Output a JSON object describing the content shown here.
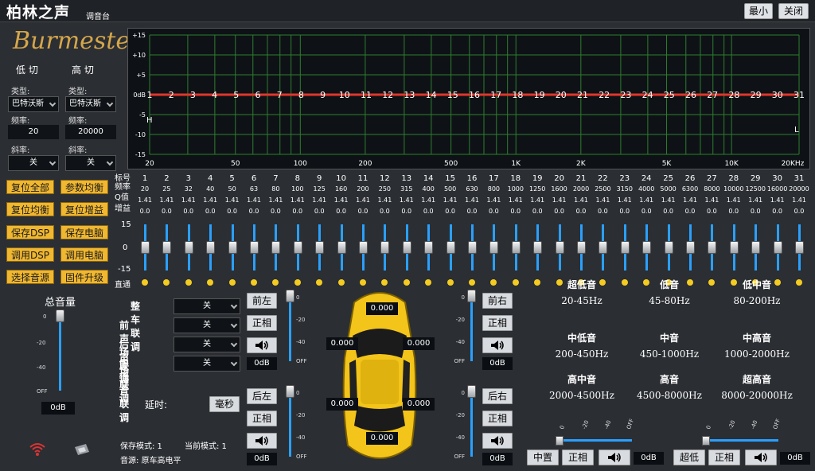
{
  "app": {
    "title": "柏林之声",
    "subtitle": "调音台",
    "min_label": "最小",
    "close_label": "关闭",
    "logo_text": "Burmester"
  },
  "crossover": {
    "low_cut": {
      "heading": "低 切",
      "type_label": "类型:",
      "type_value": "巴特沃斯",
      "freq_label": "频率:",
      "freq_value": "20",
      "slope_label": "斜率:",
      "slope_value": "关"
    },
    "high_cut": {
      "heading": "高 切",
      "type_label": "类型:",
      "type_value": "巴特沃斯",
      "freq_label": "频率:",
      "freq_value": "20000",
      "slope_label": "斜率:",
      "slope_value": "关"
    }
  },
  "buttons": [
    "复位全部",
    "参数均衡",
    "复位均衡",
    "复位增益",
    "保存DSP",
    "保存电脑",
    "调用DSP",
    "调用电脑",
    "选择音源",
    "固件升级"
  ],
  "master": {
    "label": "总音量",
    "ticks": [
      "0",
      "-20",
      "-40",
      "OFF"
    ],
    "value": "0dB",
    "level": 1.0
  },
  "graph": {
    "y_ticks": [
      "+15",
      "+10",
      "+5",
      "0dB",
      "-5",
      "-10",
      "-15"
    ],
    "x_ticks": [
      "20",
      "50",
      "100",
      "200",
      "500",
      "1K",
      "2K",
      "5K",
      "10K",
      "20KHz"
    ],
    "h_marker": "H",
    "l_marker": "L",
    "line_color": "#e0352b",
    "grid_color": "#2e7d2e"
  },
  "eq": {
    "row_labels": [
      "标号",
      "频率",
      "Q值",
      "增益"
    ],
    "gain_scale": [
      "15",
      "0",
      "-15"
    ],
    "bypass_label": "直通",
    "bands": [
      {
        "n": "1",
        "f": "20",
        "q": "1.41",
        "g": "0.0"
      },
      {
        "n": "2",
        "f": "25",
        "q": "1.41",
        "g": "0.0"
      },
      {
        "n": "3",
        "f": "32",
        "q": "1.41",
        "g": "0.0"
      },
      {
        "n": "4",
        "f": "40",
        "q": "1.41",
        "g": "0.0"
      },
      {
        "n": "5",
        "f": "50",
        "q": "1.41",
        "g": "0.0"
      },
      {
        "n": "6",
        "f": "63",
        "q": "1.41",
        "g": "0.0"
      },
      {
        "n": "7",
        "f": "80",
        "q": "1.41",
        "g": "0.0"
      },
      {
        "n": "8",
        "f": "100",
        "q": "1.41",
        "g": "0.0"
      },
      {
        "n": "9",
        "f": "125",
        "q": "1.41",
        "g": "0.0"
      },
      {
        "n": "10",
        "f": "160",
        "q": "1.41",
        "g": "0.0"
      },
      {
        "n": "11",
        "f": "200",
        "q": "1.41",
        "g": "0.0"
      },
      {
        "n": "12",
        "f": "250",
        "q": "1.41",
        "g": "0.0"
      },
      {
        "n": "13",
        "f": "315",
        "q": "1.41",
        "g": "0.0"
      },
      {
        "n": "14",
        "f": "400",
        "q": "1.41",
        "g": "0.0"
      },
      {
        "n": "15",
        "f": "500",
        "q": "1.41",
        "g": "0.0"
      },
      {
        "n": "16",
        "f": "630",
        "q": "1.41",
        "g": "0.0"
      },
      {
        "n": "17",
        "f": "800",
        "q": "1.41",
        "g": "0.0"
      },
      {
        "n": "18",
        "f": "1000",
        "q": "1.41",
        "g": "0.0"
      },
      {
        "n": "19",
        "f": "1250",
        "q": "1.41",
        "g": "0.0"
      },
      {
        "n": "20",
        "f": "1600",
        "q": "1.41",
        "g": "0.0"
      },
      {
        "n": "21",
        "f": "2000",
        "q": "1.41",
        "g": "0.0"
      },
      {
        "n": "22",
        "f": "2500",
        "q": "1.41",
        "g": "0.0"
      },
      {
        "n": "23",
        "f": "3150",
        "q": "1.41",
        "g": "0.0"
      },
      {
        "n": "24",
        "f": "4000",
        "q": "1.41",
        "g": "0.0"
      },
      {
        "n": "25",
        "f": "5000",
        "q": "1.41",
        "g": "0.0"
      },
      {
        "n": "26",
        "f": "6300",
        "q": "1.41",
        "g": "0.0"
      },
      {
        "n": "27",
        "f": "8000",
        "q": "1.41",
        "g": "0.0"
      },
      {
        "n": "28",
        "f": "10000",
        "q": "1.41",
        "g": "0.0"
      },
      {
        "n": "29",
        "f": "12500",
        "q": "1.41",
        "g": "0.0"
      },
      {
        "n": "30",
        "f": "16000",
        "q": "1.41",
        "g": "0.0"
      },
      {
        "n": "31",
        "f": "20000",
        "q": "1.41",
        "g": "0.0"
      }
    ]
  },
  "links": [
    {
      "label": "整车联调",
      "value": "关"
    },
    {
      "label": "前声场联调",
      "value": "关"
    },
    {
      "label": "后声场联调",
      "value": "关"
    },
    {
      "label": "中低音联调",
      "value": "关"
    }
  ],
  "delay": {
    "label": "延时:",
    "unit_button": "毫秒"
  },
  "channels": {
    "front_left": {
      "name": "前左",
      "phase": "正相",
      "value": "0dB",
      "delay": "0.000"
    },
    "front_right": {
      "name": "前右",
      "phase": "正相",
      "value": "0dB",
      "delay": "0.000"
    },
    "rear_left": {
      "name": "后左",
      "phase": "正相",
      "value": "0dB",
      "delay": "0.000"
    },
    "rear_right": {
      "name": "后右",
      "phase": "正相",
      "value": "0dB",
      "delay": "0.000"
    },
    "center": {
      "name": "中置",
      "phase": "正相",
      "value": "0dB",
      "delay": "0.000"
    },
    "sub": {
      "name": "超低",
      "phase": "正相",
      "value": "0dB",
      "delay": "0.000"
    },
    "car_side": {
      "left": "0.000",
      "right": "0.000"
    },
    "ch_ticks": [
      "0",
      "-20",
      "-40",
      "OFF"
    ]
  },
  "freq_bands": [
    {
      "name": "超低音",
      "range": "20-45Hz"
    },
    {
      "name": "低音",
      "range": "45-80Hz"
    },
    {
      "name": "低中音",
      "range": "80-200Hz"
    },
    {
      "name": "中低音",
      "range": "200-450Hz"
    },
    {
      "name": "中音",
      "range": "450-1000Hz"
    },
    {
      "name": "中高音",
      "range": "1000-2000Hz"
    },
    {
      "name": "高中音",
      "range": "2000-4500Hz"
    },
    {
      "name": "高音",
      "range": "4500-8000Hz"
    },
    {
      "name": "超高音",
      "range": "8000-20000Hz"
    }
  ],
  "status": {
    "save_mode": "保存模式: 1",
    "current_mode": "当前模式: 1",
    "source": "音源: 原车高电平"
  }
}
